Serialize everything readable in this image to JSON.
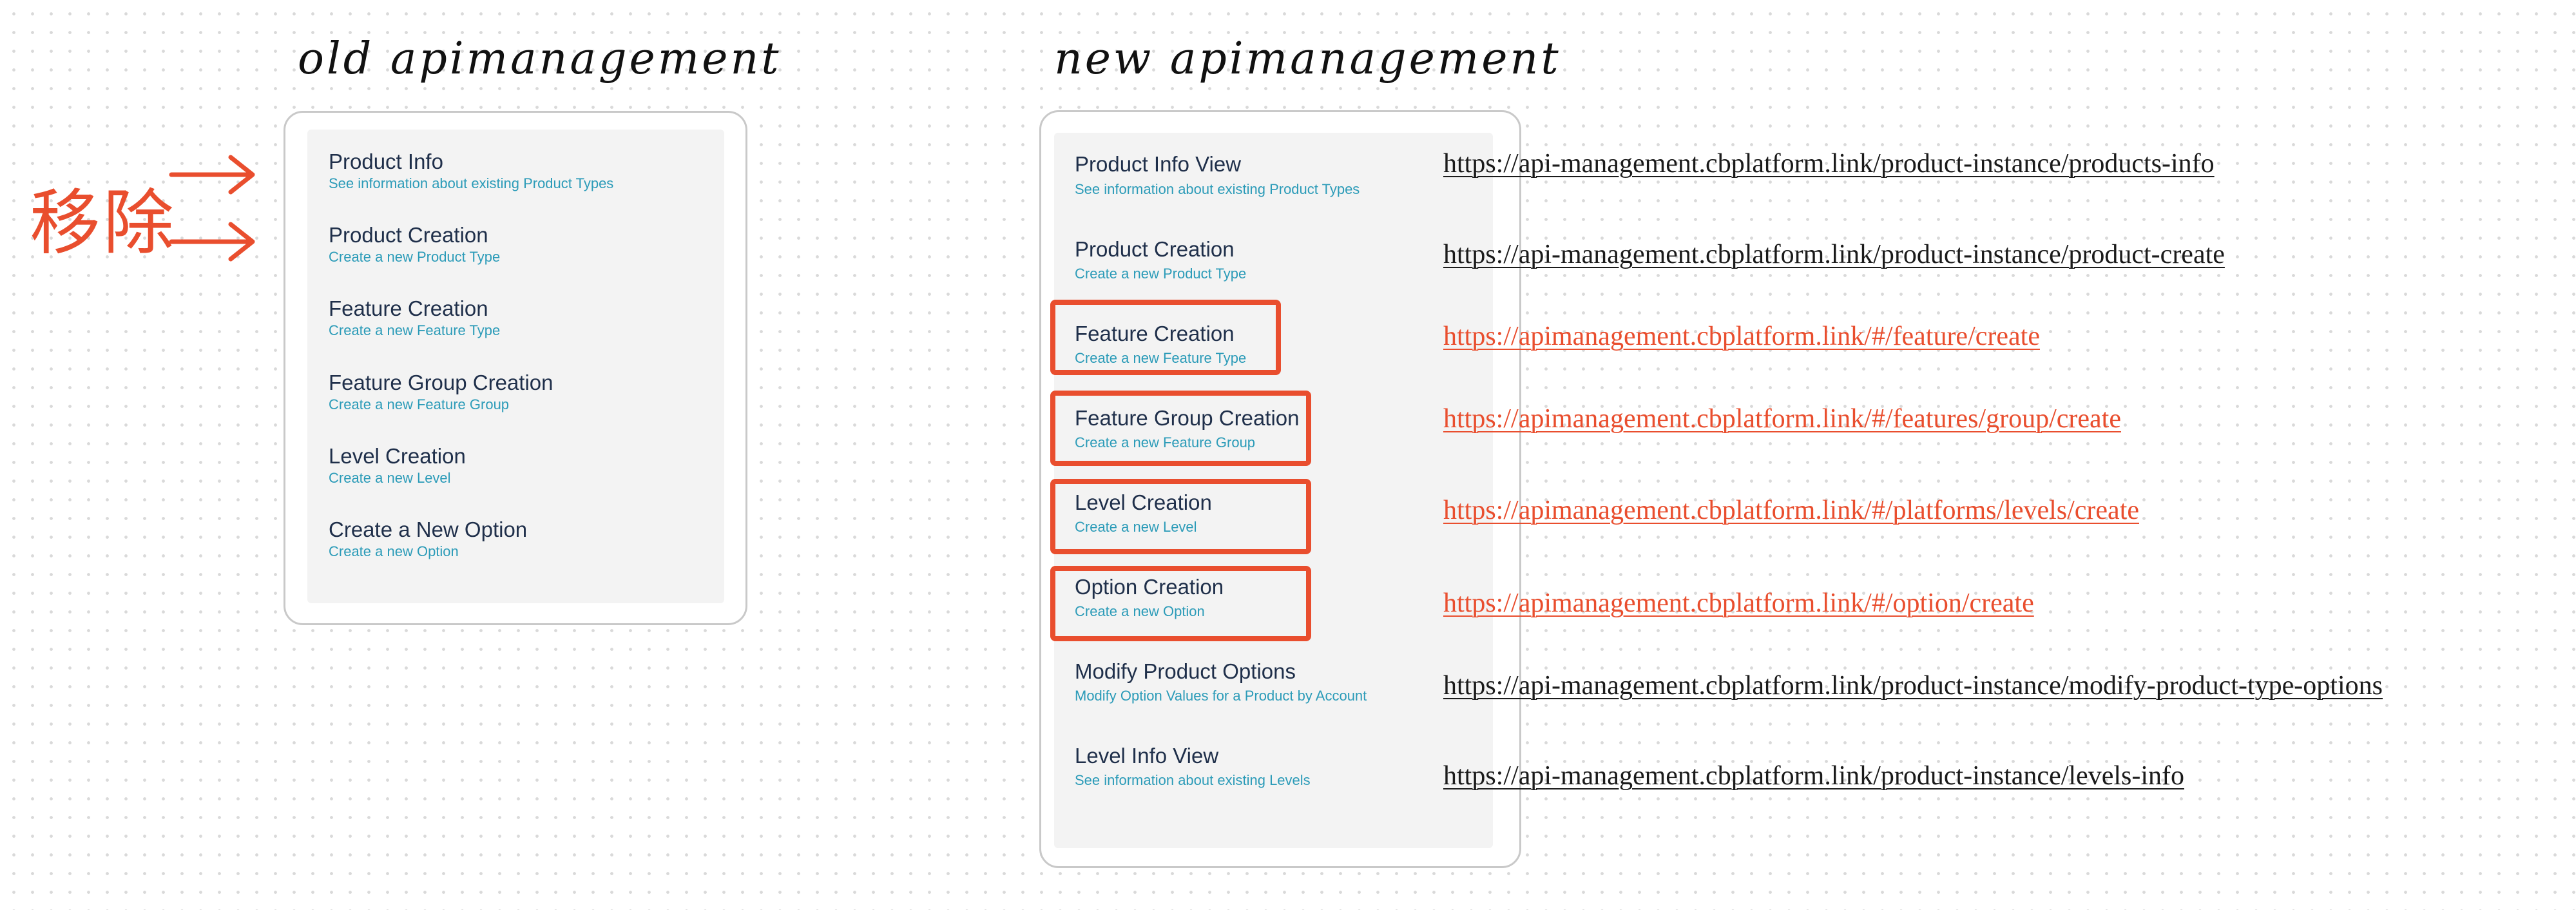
{
  "old_heading": "old apimanagement",
  "new_heading": "new apimanagement",
  "remove_label": "移除",
  "old_items": [
    {
      "title": "Product Info",
      "subtitle": "See information about existing Product Types"
    },
    {
      "title": "Product Creation",
      "subtitle": "Create a new Product Type"
    },
    {
      "title": "Feature Creation",
      "subtitle": "Create a new Feature Type"
    },
    {
      "title": "Feature Group Creation",
      "subtitle": "Create a new Feature Group"
    },
    {
      "title": "Level Creation",
      "subtitle": "Create a new Level"
    },
    {
      "title": "Create a New Option",
      "subtitle": "Create a new Option"
    }
  ],
  "new_items": [
    {
      "title": "Product Info View",
      "subtitle": "See information about existing Product Types",
      "url": "https://api-management.cbplatform.link/product-instance/products-info",
      "highlighted": false
    },
    {
      "title": "Product Creation",
      "subtitle": "Create a new Product Type",
      "url": "https://api-management.cbplatform.link/product-instance/product-create",
      "highlighted": false
    },
    {
      "title": "Feature Creation",
      "subtitle": "Create a new Feature Type",
      "url": "https://apimanagement.cbplatform.link/#/feature/create",
      "highlighted": true
    },
    {
      "title": "Feature Group Creation",
      "subtitle": "Create a new Feature Group",
      "url": "https://apimanagement.cbplatform.link/#/features/group/create",
      "highlighted": true
    },
    {
      "title": "Level Creation",
      "subtitle": "Create a new Level",
      "url": "https://apimanagement.cbplatform.link/#/platforms/levels/create",
      "highlighted": true
    },
    {
      "title": "Option Creation",
      "subtitle": "Create a new Option",
      "url": "https://apimanagement.cbplatform.link/#/option/create",
      "highlighted": true
    },
    {
      "title": "Modify Product Options",
      "subtitle": "Modify Option Values for a Product by Account",
      "url": "https://api-management.cbplatform.link/product-instance/modify-product-type-options",
      "highlighted": false
    },
    {
      "title": "Level Info View",
      "subtitle": "See information about existing Levels",
      "url": "https://api-management.cbplatform.link/product-instance/levels-info",
      "highlighted": false
    }
  ],
  "colors": {
    "accent": "#e94e2e",
    "subtitle": "#2b9bb8",
    "title": "#1f2f4a"
  },
  "icons": [
    "right-arrow-icon",
    "right-arrow-icon"
  ]
}
